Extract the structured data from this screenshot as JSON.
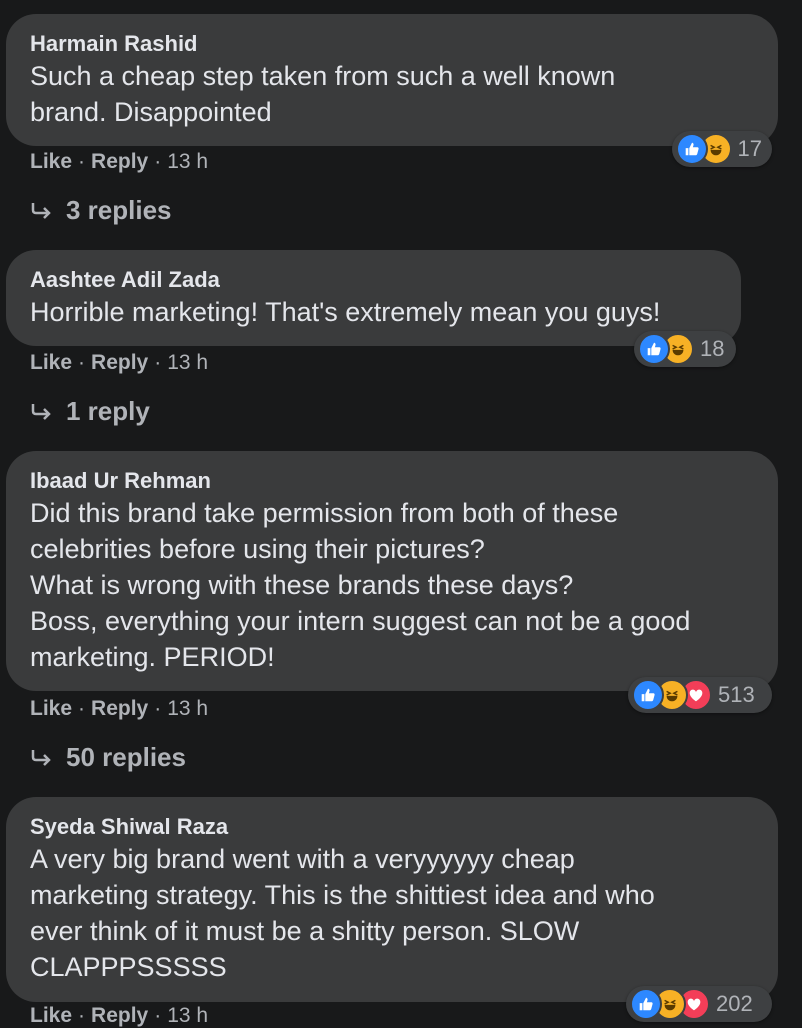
{
  "comments": [
    {
      "author": "Harmain Rashid",
      "text": "Such a cheap step taken from such a well known\nbrand. Disappointed",
      "like": "Like",
      "reply": "Reply",
      "time": "13 h",
      "reaction_count": "17",
      "replies": "3 replies"
    },
    {
      "author": "Aashtee Adil Zada",
      "text": "Horrible marketing! That's extremely mean you guys!",
      "like": "Like",
      "reply": "Reply",
      "time": "13 h",
      "reaction_count": "18",
      "replies": "1 reply"
    },
    {
      "author": "Ibaad Ur Rehman",
      "text": "Did this brand take permission from both of these\ncelebrities before using their pictures?\nWhat is wrong with these brands these days?\nBoss, everything your intern suggest can not be a good\nmarketing. PERIOD!",
      "like": "Like",
      "reply": "Reply",
      "time": "13 h",
      "reaction_count": "513",
      "replies": "50 replies"
    },
    {
      "author": "Syeda Shiwal Raza",
      "text": "A very big brand went with a veryyyyyy cheap\nmarketing strategy. This is the shittiest idea and who\never think of it must be a shitty person. SLOW\nCLAPPPSSSSS",
      "like": "Like",
      "reply": "Reply",
      "time": "13 h",
      "reaction_count": "202"
    }
  ],
  "icons": {
    "like": "like-reaction-icon",
    "haha": "haha-reaction-icon",
    "love": "love-reaction-icon",
    "reply_arrow": "reply-arrow-icon"
  },
  "colors": {
    "background": "#18191a",
    "bubble": "#3a3b3c",
    "like_blue": "#2d88ff",
    "haha_yellow": "#f7b125",
    "love_red": "#f33e58",
    "secondary_text": "#b0b3b8"
  }
}
